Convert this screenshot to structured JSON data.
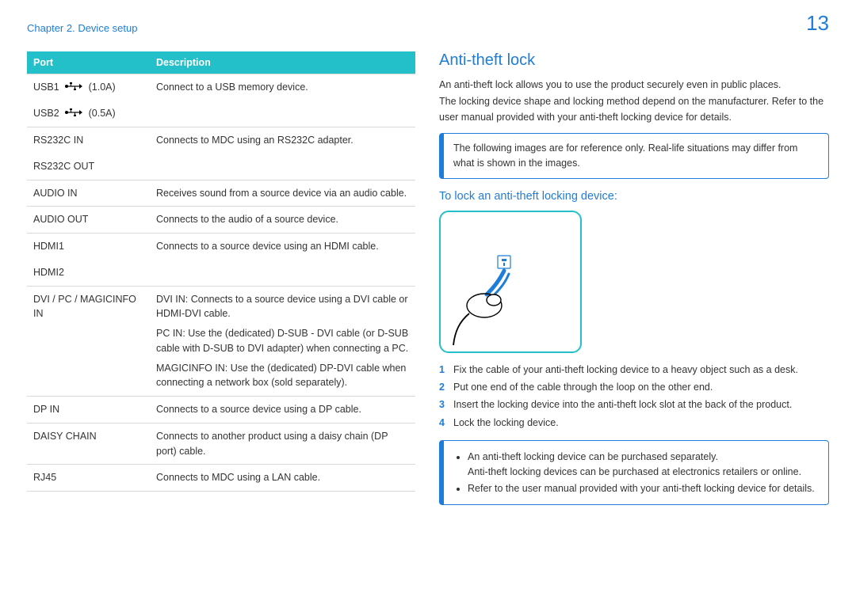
{
  "page_number": "13",
  "breadcrumb": "Chapter 2. Device setup",
  "port_table": {
    "headers": {
      "port": "Port",
      "desc": "Description"
    },
    "rows": {
      "usb1": {
        "port_pre": "USB1 ",
        "port_post": " (1.0A)",
        "desc": "Connect to a USB memory device."
      },
      "usb2": {
        "port_pre": "USB2 ",
        "port_post": " (0.5A)",
        "desc": ""
      },
      "rs_in": {
        "port": "RS232C IN",
        "desc": "Connects to MDC using an RS232C adapter."
      },
      "rs_out": {
        "port": "RS232C OUT",
        "desc": ""
      },
      "aud_in": {
        "port": "AUDIO IN",
        "desc": "Receives sound from a source device via an audio cable."
      },
      "aud_out": {
        "port": "AUDIO OUT",
        "desc": "Connects to the audio of a source device."
      },
      "hdmi1": {
        "port": "HDMI1",
        "desc": "Connects to a source device using an HDMI cable."
      },
      "hdmi2": {
        "port": "HDMI2",
        "desc": ""
      },
      "dvi": {
        "port": "DVI / PC / MAGICINFO IN",
        "d1": "DVI IN: Connects to a source device using a DVI cable or HDMI-DVI cable.",
        "d2": "PC IN: Use the (dedicated) D-SUB - DVI cable (or D-SUB cable with D-SUB to DVI adapter) when connecting a PC.",
        "d3": "MAGICINFO IN: Use the (dedicated) DP-DVI cable when connecting a network box (sold separately)."
      },
      "dp": {
        "port": "DP IN",
        "desc": "Connects to a source device using a DP cable."
      },
      "daisy": {
        "port": "DAISY CHAIN",
        "desc": "Connects to another product using a daisy chain (DP port) cable."
      },
      "rj45": {
        "port": "RJ45",
        "desc": "Connects to MDC using a LAN cable."
      }
    }
  },
  "section": {
    "title": "Anti-theft lock",
    "intro1": "An anti-theft lock allows you to use the product securely even in public places.",
    "intro2": "The locking device shape and locking method depend on the manufacturer. Refer to the user manual provided with your anti-theft locking device for details.",
    "note1": "The following images are for reference only. Real-life situations may differ from what is shown in the images.",
    "sub_title": "To lock an anti-theft locking device:",
    "steps": {
      "s1": "Fix the cable of your anti-theft locking device to a heavy object such as a desk.",
      "s2": "Put one end of the cable through the loop on the other end.",
      "s3": "Insert the locking device into the anti-theft lock slot at the back of the product.",
      "s4": "Lock the locking device."
    },
    "note2": {
      "b1a": "An anti-theft locking device can be purchased separately.",
      "b1b": "Anti-theft locking devices can be purchased at electronics retailers or online.",
      "b2": "Refer to the user manual provided with your anti-theft locking device for details."
    }
  }
}
